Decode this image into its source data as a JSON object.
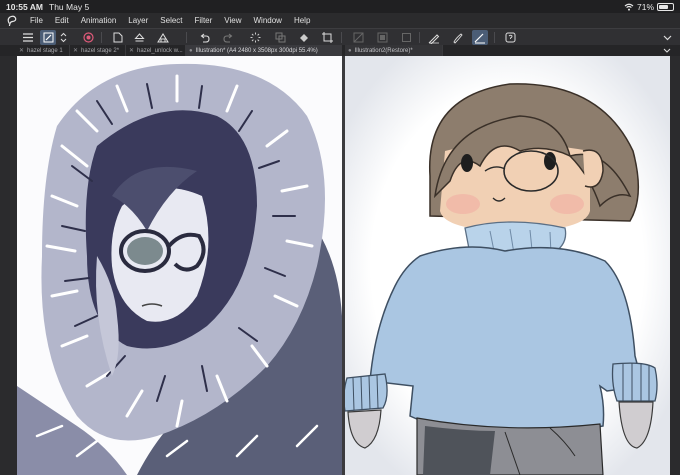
{
  "status_bar": {
    "time": "10:55 AM",
    "date": "Thu May 5",
    "battery": "71%",
    "battery_level": 0.71
  },
  "menu": {
    "items": [
      "File",
      "Edit",
      "Animation",
      "Layer",
      "Select",
      "Filter",
      "View",
      "Window",
      "Help"
    ]
  },
  "toolbar": {
    "icons": [
      "menu-icon",
      "brush-active-icon",
      "chevrons-icon",
      "target-icon",
      "new-file-icon",
      "eject-icon",
      "upload-icon",
      "undo-icon",
      "redo-icon",
      "busy-icon",
      "copy-icon",
      "clear-icon",
      "fill-icon",
      "transform-icon",
      "deselect-icon",
      "invert-icon",
      "square-icon",
      "pen-icon",
      "brush-icon",
      "ruler-icon",
      "help-icon"
    ]
  },
  "tabs": [
    {
      "label": "hazel stage 1"
    },
    {
      "label": "hazel stage 2*"
    },
    {
      "label": "hazel_unlock w..."
    },
    {
      "label": "Illustration* (A4 2480 x 3508px 300dpi 55.4%)"
    },
    {
      "label": "Illustration2(Restore)*"
    }
  ],
  "colors": {
    "ui_background": "#2b2b2d",
    "active_tool": "#4b5d76",
    "sweater": "#aac6e2",
    "hair": "#8d7d6d",
    "skin": "#f1d0b4",
    "pants": "#555a5e"
  }
}
